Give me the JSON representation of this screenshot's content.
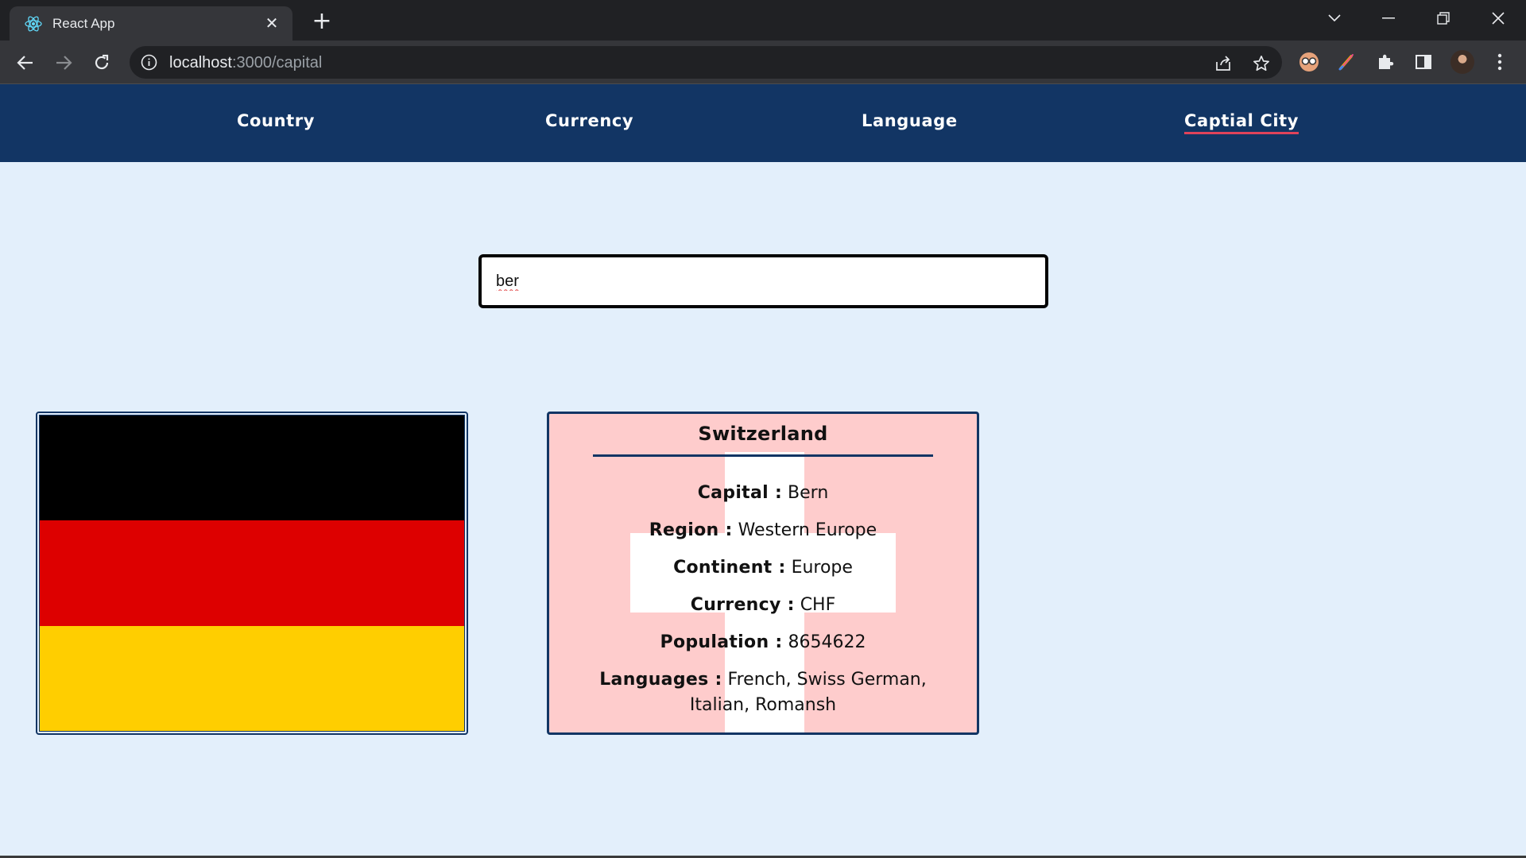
{
  "browser": {
    "tab_title": "React App",
    "tab_close": "✕",
    "new_tab": "+",
    "url_host": "localhost",
    "url_path": ":3000/capital"
  },
  "nav": {
    "items": [
      {
        "label": "Country",
        "active": false
      },
      {
        "label": "Currency",
        "active": false
      },
      {
        "label": "Language",
        "active": false
      },
      {
        "label": "Captial City",
        "active": true
      }
    ],
    "accent_color": "#e0435a",
    "bg_color": "#123564"
  },
  "search": {
    "value": "ber"
  },
  "flag": {
    "country": "Germany",
    "stripes": [
      "#000000",
      "#dd0000",
      "#ffce00"
    ]
  },
  "result": {
    "country": "Switzerland",
    "fields": [
      {
        "key": "Capital :",
        "value": "Bern"
      },
      {
        "key": "Region :",
        "value": "Western Europe"
      },
      {
        "key": "Continent :",
        "value": "Europe"
      },
      {
        "key": "Currency :",
        "value": "CHF"
      },
      {
        "key": "Population :",
        "value": "8654622"
      },
      {
        "key": "Languages :",
        "value": "French, Swiss German, Italian, Romansh"
      }
    ],
    "card_bg": "#fecccc"
  }
}
